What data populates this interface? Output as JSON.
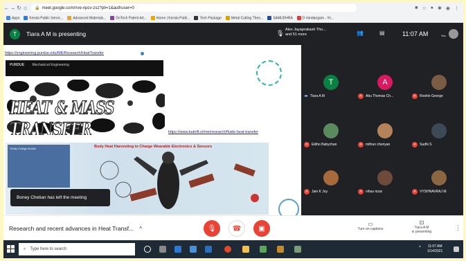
{
  "browser": {
    "url": "meet.google.com/nve-npcv-zsz?pli=1&authuser=0",
    "bookmarks": [
      "Apps",
      "Kerala Public Servic...",
      "Advanced Materials...",
      "DoTech Patent Art...",
      "Home | Kerala Publi...",
      "Tech Package",
      "Metal Cutting Theo...",
      "SAMUDHRA",
      "D mindangam - Yo..."
    ]
  },
  "meet": {
    "presenter_initial": "T",
    "presenting_text": "Tiara A M is presenting",
    "others_line1": "Alex Jayaprakash Tho...",
    "others_line2": "and 51 more",
    "time": "11:07 AM",
    "you_label": "You"
  },
  "slide": {
    "url1": "https://engineering.purdue.edu/ME/Research/HeatTransfer",
    "purdue_label": "PURDUE",
    "purdue_sub": "Mechanical Engineering",
    "banner_text": "HEAT & MASS TRANSFER",
    "url2": "https://www.tudelft.nl/me/research/fluids-heat-transfer",
    "poster_title": "Body Heat Harvesting to Charge Wearable Electronics & Sensors",
    "poster_left_text": "Trinity College Dublin"
  },
  "toast": "Boney Chetian has left the meeting",
  "participants": [
    {
      "name": "Tiara A M",
      "initial": "T",
      "color": "#0b8043",
      "speaking": true
    },
    {
      "name": "Abu Thomas Ch...",
      "initial": "A",
      "color": "#d81b60",
      "speaking": false
    },
    {
      "name": "Roshin George",
      "initial": "",
      "color": "#7a5c44",
      "speaking": false
    },
    {
      "name": "Eldho Babychan",
      "initial": "",
      "color": "#5b8a5e",
      "speaking": false
    },
    {
      "name": "mithun cheriyan",
      "initial": "",
      "color": "#b5835a",
      "speaking": false
    },
    {
      "name": "Sudhi S",
      "initial": "",
      "color": "#3d4a56",
      "speaking": false
    },
    {
      "name": "Jain K Joy",
      "initial": "",
      "color": "#a66a3c",
      "speaking": false
    },
    {
      "name": "nihas nizar",
      "initial": "",
      "color": "#6d4a3a",
      "speaking": false
    },
    {
      "name": "VYSHNAVRAJ M",
      "initial": "",
      "color": "#8a6642",
      "speaking": false
    }
  ],
  "bottom": {
    "meeting_title": "Research and recent advances in Heat Transf...",
    "captions_label": "Turn on captions",
    "presenting_label_1": "Tiara A M",
    "presenting_label_2": "is presenting"
  },
  "taskbar": {
    "search_placeholder": "Type here to search",
    "tray_time": "11:07 AM",
    "tray_date": "1/14/2021"
  }
}
